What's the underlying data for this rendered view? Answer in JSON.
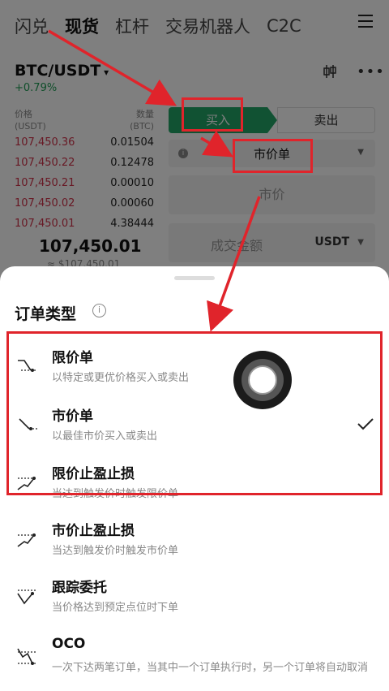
{
  "topnav": {
    "tabs": [
      "闪兑",
      "现货",
      "杠杆",
      "交易机器人",
      "C2C"
    ],
    "active_index": 1
  },
  "market": {
    "pair": "BTC/USDT",
    "change": "+0.79%",
    "change_color": "#1f9d55"
  },
  "orderbook": {
    "price_header": "价格",
    "price_unit": "(USDT)",
    "qty_header": "数量",
    "qty_unit": "(BTC)",
    "asks": [
      {
        "price": "107,450.36",
        "qty": "0.01504"
      },
      {
        "price": "107,450.22",
        "qty": "0.12478"
      },
      {
        "price": "107,450.21",
        "qty": "0.00010"
      },
      {
        "price": "107,450.02",
        "qty": "0.00060"
      },
      {
        "price": "107,450.01",
        "qty": "4.38444"
      }
    ],
    "last_price": "107,450.01",
    "last_fiat": "≈ $107,450.01"
  },
  "trade_form": {
    "buy_label": "买入",
    "sell_label": "卖出",
    "order_type_value": "市价单",
    "price_placeholder": "市价",
    "amount_label": "成交金额",
    "amount_unit": "USDT"
  },
  "sheet": {
    "title": "订单类型",
    "options": [
      {
        "name": "限价单",
        "desc": "以特定或更优价格买入或卖出",
        "icon": "limit-order-icon",
        "selected": false
      },
      {
        "name": "市价单",
        "desc": "以最佳市价买入或卖出",
        "icon": "market-order-icon",
        "selected": true
      },
      {
        "name": "限价止盈止损",
        "desc": "当达到触发价时触发限价单",
        "icon": "limit-tpsl-icon",
        "selected": false
      },
      {
        "name": "市价止盈止损",
        "desc": "当达到触发价时触发市价单",
        "icon": "market-tpsl-icon",
        "selected": false
      },
      {
        "name": "跟踪委托",
        "desc": "当价格达到预定点位时下单",
        "icon": "trailing-order-icon",
        "selected": false
      },
      {
        "name": "OCO",
        "desc": "一次下达两笔订单，当其中一个订单执行时，另一个订单将自动取消",
        "icon": "oco-icon",
        "selected": false
      }
    ]
  },
  "colors": {
    "buy": "#23a567",
    "ask_price": "#d0334a",
    "annotation": "#e0242b"
  }
}
